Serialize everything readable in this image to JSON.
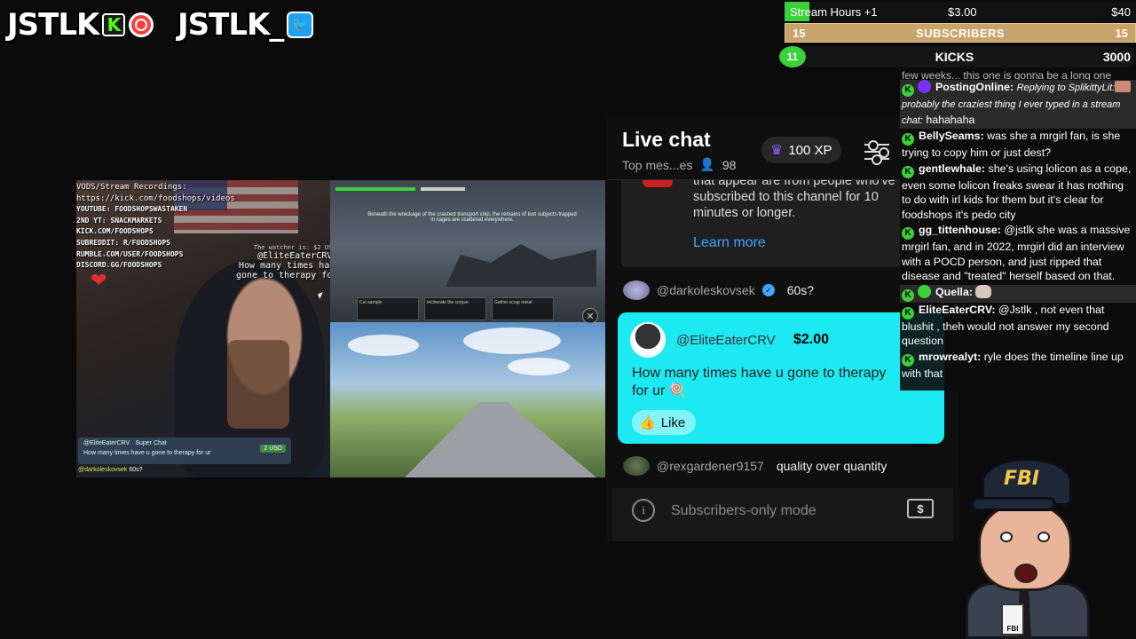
{
  "branding": {
    "logo_kick_text": "JSTLK",
    "kick_letter": "K",
    "logo_twitter_text": "JSTLK_",
    "twitter_glyph": "🐦"
  },
  "goals": {
    "hours_label": "Stream Hours +1",
    "hours_mid": "$3.00",
    "hours_right": "$40",
    "hours_progress": 0.07,
    "subs_left": "15",
    "subs_label": "SUBSCRIBERS",
    "subs_right": "15",
    "kicks_left": "11",
    "kicks_label": "KICKS",
    "kicks_right": "3000",
    "colors": {
      "green": "#3ad13a",
      "gold": "#c9a46a"
    }
  },
  "stream": {
    "overlay_lines": [
      "VODS/Stream Recordings: https://kick.com/foodshops/videos",
      "YOUTUBE: FOODSHOPSWASTAKEN",
      "2ND YT: SNACKMARKETS",
      "KICK.COM/FOODSHOPS",
      "SUBREDDIT: R/FOODSHOPS",
      "RUMBLE.COM/USER/FOODSHOPS",
      "DISCORD.GG/FOODSHOPS"
    ],
    "tts_sub": "The watcher is: $2 USD",
    "tts_user": "@EliteEaterCRV",
    "tts_line1": "How many times have u",
    "tts_line2": "gone to therapy for ur",
    "donation_text": "How many times have u gone to therapy for ur",
    "donation_user": "@EliteEaterCRV · Super Chat",
    "donation_amount": "2 USD",
    "bottom_chat_user": "@darkoleskovsek",
    "bottom_chat_text": "60s?",
    "game_caption": "Beneath the wreckage of the crashed transport ship, the remains of lost subjects trapped in cages are scattered everywhere.",
    "game_cards": [
      "Cut sample",
      "Incinerate the corpse",
      "Gather scrap metal"
    ]
  },
  "ytchat": {
    "title": "Live chat",
    "mode": "Top mes...es",
    "viewers": "98",
    "xp": "100 XP",
    "notice_text_clip": "that appear are from people who've",
    "notice_text": "subscribed to this channel for 10 minutes or longer.",
    "learn_more": "Learn more",
    "messages": [
      {
        "author": "@darkoleskovsek",
        "text": "60s?",
        "verified": true
      },
      {
        "author": "@rexgardener9157",
        "text": "quality over quantity",
        "verified": false
      }
    ],
    "superchat": {
      "author": "@EliteEaterCRV",
      "amount": "$2.00",
      "text": "How many times have u gone to therapy for ur 🍭",
      "like": "Like",
      "color": "#1de9f3"
    },
    "input_placeholder": "Subscribers-only mode",
    "info_glyph": "i",
    "dollar_glyph": "$"
  },
  "kickchat": {
    "top_clip": "few weeks... this one is gonna be a long one",
    "messages": [
      {
        "name": "PostingOnline:",
        "reply": "Replying to SplikittyLit:",
        "reply_text": "probably the craziest thing I ever typed in a stream chat:",
        "text": "hahahaha",
        "hl": true,
        "badge_color": "#7b2ff7"
      },
      {
        "name": "BellySeams:",
        "text": "was she a mrgirl fan, is she trying to copy him or just dest?"
      },
      {
        "name": "gentlewhale:",
        "text": "she's using lolicon as a cope, even some lolicon freaks swear it has nothing to do with irl kids for them but it's clear for foodshops it's pedo city"
      },
      {
        "name": "gg_tittenhouse:",
        "text": "@jstlk she was a massive mrgirl fan, and in 2022, mrgirl did an interview with a POCD person, and just ripped that disease and \"treated\" herself based on that."
      },
      {
        "name": "Quella:",
        "text": "",
        "hl": true,
        "badge_color": "#3ad13a",
        "cat": true
      },
      {
        "name": "EliteEaterCRV:",
        "text": "@Jstlk , not even that blushit , theh would not answer my second question"
      },
      {
        "name": "mrowrealyt:",
        "text": "ryle does the timeline line up with that"
      }
    ]
  },
  "mascot": {
    "cap_text": "FBI",
    "badge_text": "FBI"
  }
}
